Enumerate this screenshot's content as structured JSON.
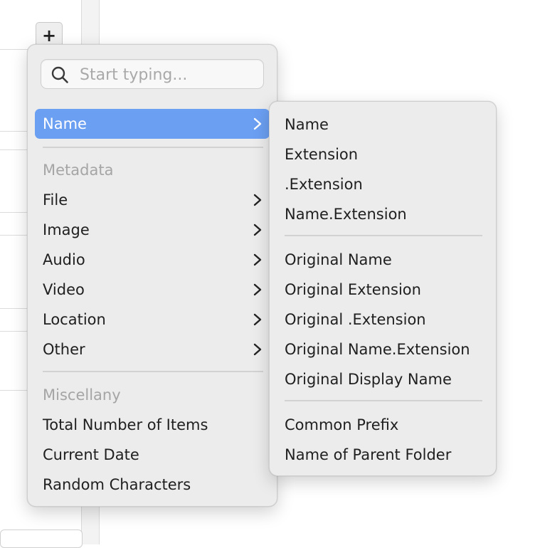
{
  "toolbar": {
    "add_label": "+"
  },
  "search": {
    "placeholder": "Start typing..."
  },
  "menu": {
    "selected_item": "Name",
    "metadata_header": "Metadata",
    "metadata_items": [
      "File",
      "Image",
      "Audio",
      "Video",
      "Location",
      "Other"
    ],
    "misc_header": "Miscellany",
    "misc_items": [
      "Total Number of Items",
      "Current Date",
      "Random Characters"
    ]
  },
  "submenu": {
    "group1": [
      "Name",
      "Extension",
      ".Extension",
      "Name.Extension"
    ],
    "group2": [
      "Original Name",
      "Original Extension",
      "Original .Extension",
      "Original Name.Extension",
      "Original Display Name"
    ],
    "group3": [
      "Common Prefix",
      "Name of Parent Folder"
    ]
  },
  "colors": {
    "accent": "#6b9ff2",
    "menu_bg": "#ececec",
    "secondary_text": "#a5a5a5"
  },
  "icons": {
    "search": "magnifier-icon",
    "chevron": "chevron-right-icon"
  }
}
